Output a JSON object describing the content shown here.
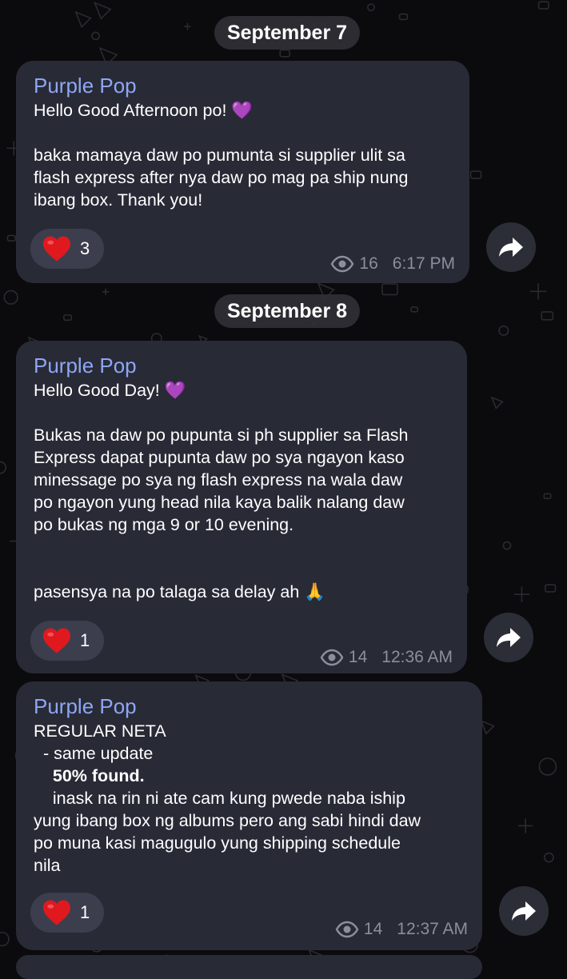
{
  "messages": [
    {
      "date": "September 7",
      "sender": "Purple Pop",
      "lines": [
        {
          "text": "Hello Good Afternoon po! 💜",
          "bold": false
        },
        {
          "text": "",
          "bold": false
        },
        {
          "text": "baka mamaya daw po pumunta si supplier ulit sa",
          "bold": false
        },
        {
          "text": "flash express after nya daw po mag pa ship nung",
          "bold": false
        },
        {
          "text": "ibang box. Thank you!",
          "bold": false
        }
      ],
      "reaction": {
        "icon": "red-heart-icon",
        "count": "3"
      },
      "views": "16",
      "time": "6:17 PM"
    },
    {
      "date": "September 8",
      "sender": "Purple Pop",
      "lines": [
        {
          "text": "Hello Good Day! 💜",
          "bold": false
        },
        {
          "text": "",
          "bold": false
        },
        {
          "text": "Bukas na daw po pupunta si ph supplier sa Flash",
          "bold": false
        },
        {
          "text": "Express dapat pupunta daw po sya ngayon kaso",
          "bold": false
        },
        {
          "text": "minessage po sya ng flash express na wala daw",
          "bold": false
        },
        {
          "text": "po ngayon yung head nila kaya balik nalang daw",
          "bold": false
        },
        {
          "text": "po bukas ng mga 9 or 10 evening.",
          "bold": false
        },
        {
          "text": "",
          "bold": false
        },
        {
          "text": "",
          "bold": false
        },
        {
          "text": "pasensya na po talaga sa delay ah 🙏",
          "bold": false
        }
      ],
      "reaction": {
        "icon": "red-heart-icon",
        "count": "1"
      },
      "views": "14",
      "time": "12:36 AM"
    },
    {
      "date": "",
      "sender": "Purple Pop",
      "lines": [
        {
          "text": "REGULAR NETA",
          "bold": false
        },
        {
          "text": "  - same update",
          "bold": false
        },
        {
          "text": "    50% found.",
          "bold": true
        },
        {
          "text": "    inask na rin ni ate cam kung pwede naba iship",
          "bold": false
        },
        {
          "text": "yung ibang box ng albums pero ang sabi hindi daw",
          "bold": false
        },
        {
          "text": "po muna kasi magugulo yung shipping schedule",
          "bold": false
        },
        {
          "text": "nila",
          "bold": false
        }
      ],
      "reaction": {
        "icon": "red-heart-icon",
        "count": "1"
      },
      "views": "14",
      "time": "12:37 AM"
    }
  ],
  "icons": {
    "forward": "forward-arrow-icon",
    "views": "eye-icon"
  },
  "colors": {
    "background": "#0b0b0d",
    "bubble": "#282a36",
    "sender_name": "#8ea6f4",
    "meta_text": "#8c8e9c",
    "reaction_pill": "#3c3e4e",
    "heart": "#e0191f"
  }
}
